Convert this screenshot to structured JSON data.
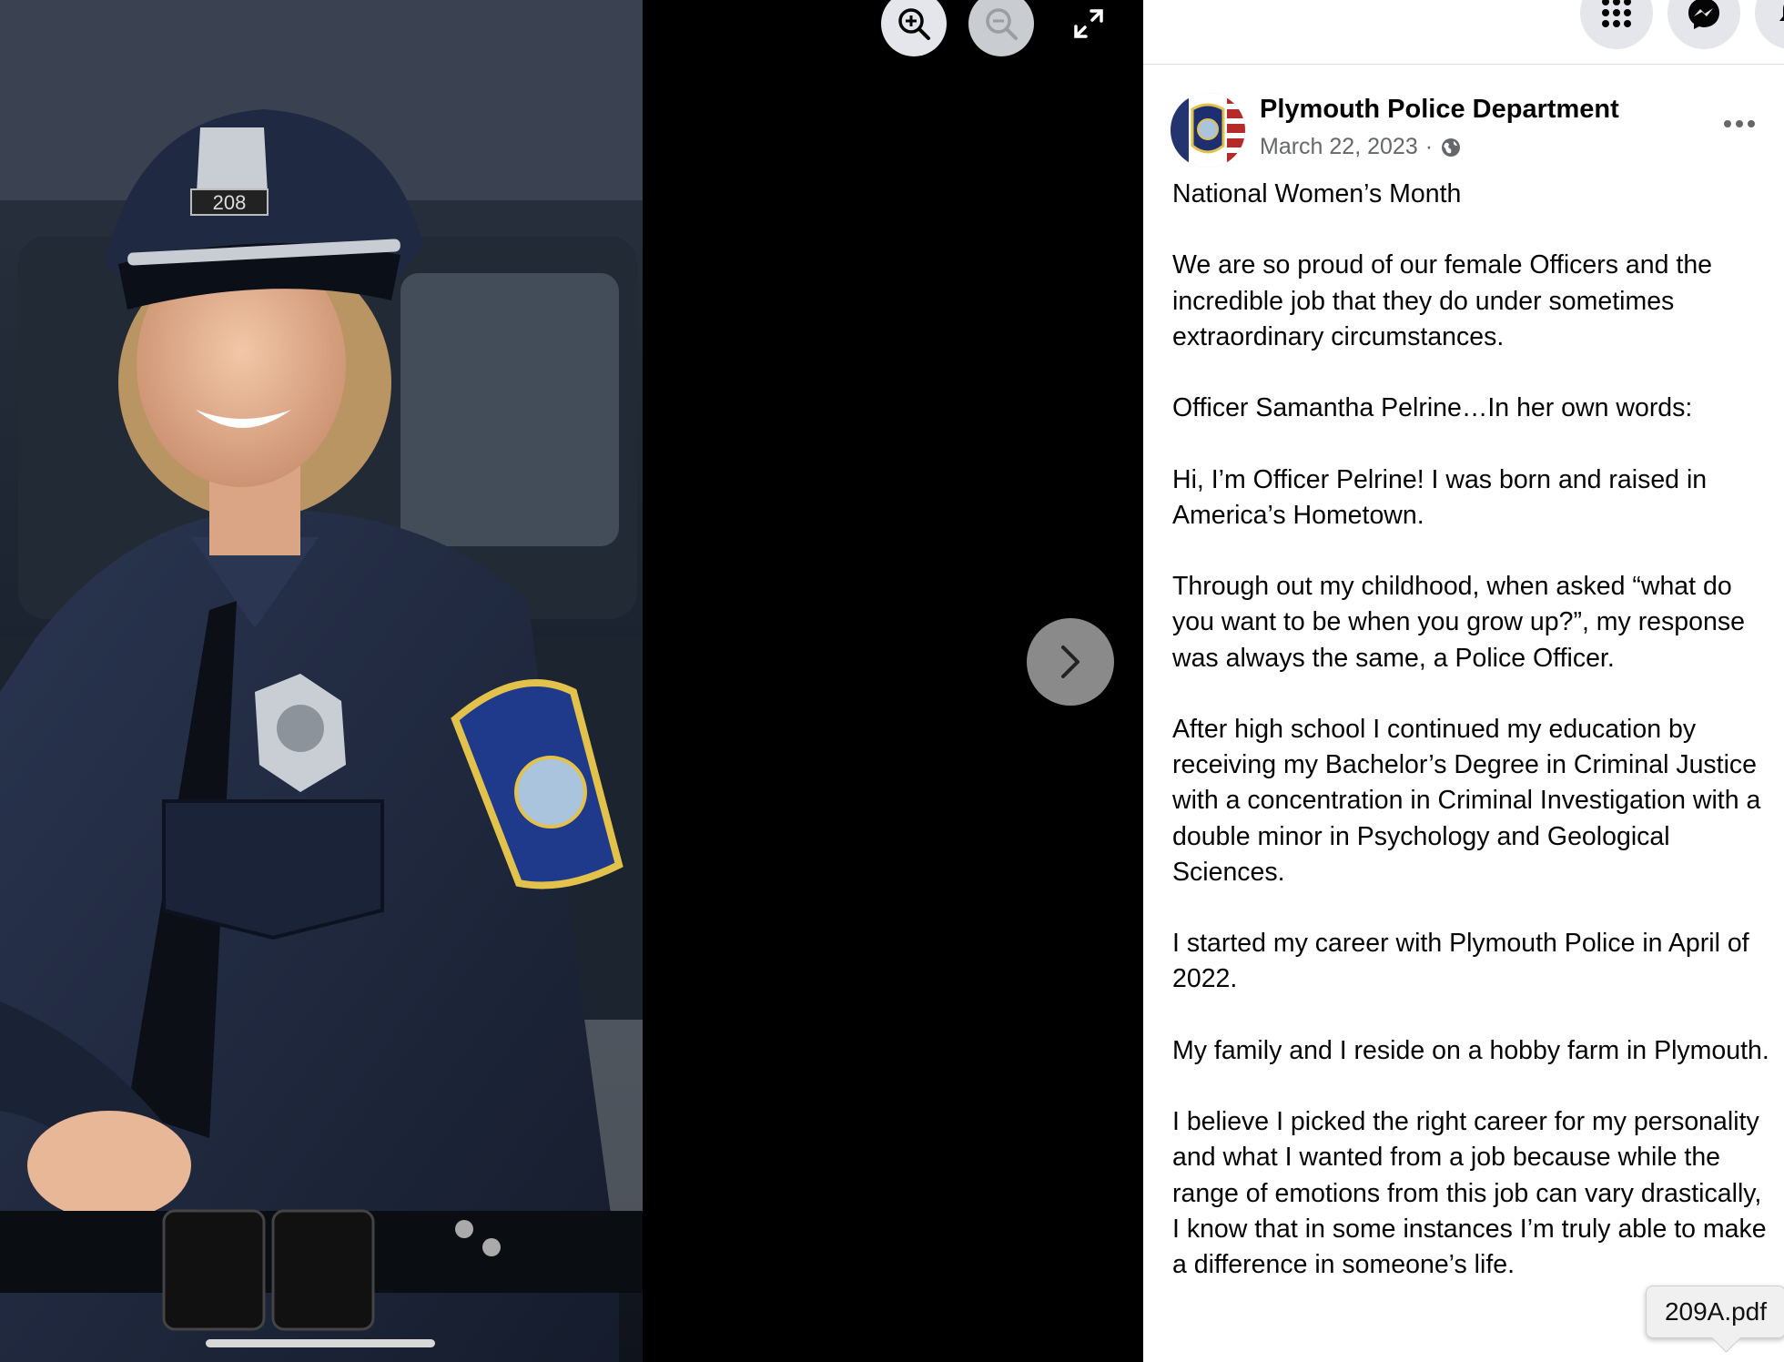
{
  "viewer": {
    "zoom_in_icon": "zoom-in-icon",
    "zoom_out_icon": "zoom-out-icon",
    "expand_icon": "expand-icon",
    "next_icon": "chevron-right-icon",
    "photo_badge_number": "208"
  },
  "topbar": {
    "menu_icon": "grid-menu-icon",
    "messenger_icon": "messenger-icon",
    "notification_icon": "bell-icon"
  },
  "post": {
    "page_name": "Plymouth Police Department",
    "date": "March 22, 2023",
    "separator": "·",
    "audience_icon": "globe-icon",
    "more_icon": "more-options-icon",
    "paragraphs": [
      "National Women’s Month",
      "We are so proud of our female Officers and the incredible job that they do under sometimes extraordinary circumstances.",
      "Officer Samantha Pelrine…In her own words:",
      "Hi, I’m Officer Pelrine! I was born and raised in America’s Hometown.",
      "Through out my childhood, when asked “what do you want to be when you grow up?”, my response was always the same, a Police Officer.",
      "After high school I continued my education by receiving my Bachelor’s Degree in Criminal Justice with a concentration in Criminal Investigation with a double minor in Psychology and Geological Sciences.",
      "I started my career with Plymouth Police in April of 2022.",
      "My family and I reside on a hobby farm in Plymouth.",
      "I believe I picked the right career for my personality and what I wanted from a job because while the range of emotions from this job can vary drastically, I know that in some instances I’m truly able to make a difference in someone’s life."
    ]
  },
  "tooltip": {
    "filename": "209A.pdf"
  }
}
